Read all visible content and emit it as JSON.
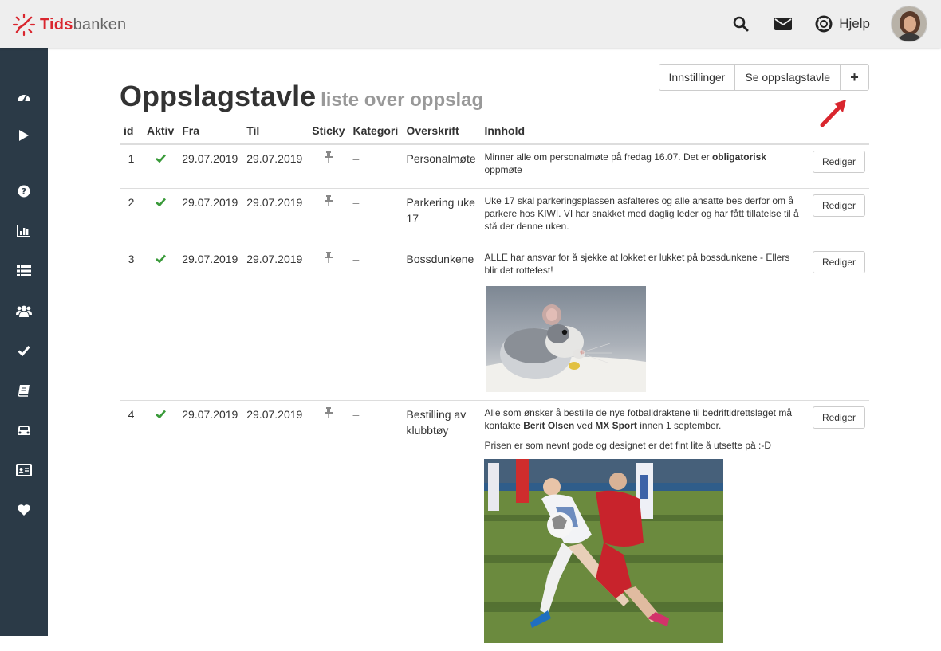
{
  "app": {
    "logo_part1": "Tids",
    "logo_part2": "banken"
  },
  "topbar": {
    "help_label": "Hjelp"
  },
  "header": {
    "title": "Oppslagstavle",
    "subtitle": "liste over oppslag"
  },
  "toolbar": {
    "settings_label": "Innstillinger",
    "view_label": "Se oppslagstavle",
    "add_label": "+"
  },
  "table": {
    "columns": [
      "id",
      "Aktiv",
      "Fra",
      "Til",
      "Sticky",
      "Kategori",
      "Overskrift",
      "Innhold"
    ],
    "rows": [
      {
        "id": "1",
        "from": "29.07.2019",
        "to": "29.07.2019",
        "category": "–",
        "heading": "Personalmøte",
        "content_a": "Minner alle om personalmøte på fredag 16.07. Det er ",
        "content_b": "obligatorisk",
        "content_c": " oppmøte",
        "edit_label": "Rediger"
      },
      {
        "id": "2",
        "from": "29.07.2019",
        "to": "29.07.2019",
        "category": "–",
        "heading": "Parkering uke 17",
        "content": "Uke 17 skal parkeringsplassen asfalteres og alle ansatte bes derfor om å parkere hos KIWI. VI har snakket med daglig leder og har fått tillatelse til å stå der denne uken.",
        "edit_label": "Rediger"
      },
      {
        "id": "3",
        "from": "29.07.2019",
        "to": "29.07.2019",
        "category": "–",
        "heading": "Bossdunkene",
        "content": "ALLE har ansvar for å sjekke at lokket er lukket på bossdunkene - Ellers blir det rottefest!",
        "edit_label": "Rediger"
      },
      {
        "id": "4",
        "from": "29.07.2019",
        "to": "29.07.2019",
        "category": "–",
        "heading": "Bestilling av klubbtøy",
        "content_a": "Alle som ønsker å bestille de nye fotballdraktene til bedriftidrettslaget må kontakte ",
        "content_b": "Berit Olsen",
        "content_c": " ved ",
        "content_d": "MX Sport",
        "content_e": " innen 1 september.",
        "content_p2": "Prisen er som nevnt gode og designet er det fint lite å utsette på :-D",
        "edit_label": "Rediger"
      }
    ]
  },
  "colors": {
    "sidebar": "#2b3a47",
    "brand_red": "#d9262e",
    "check_green": "#3a9a3a",
    "arrow_red": "#d9262e"
  }
}
